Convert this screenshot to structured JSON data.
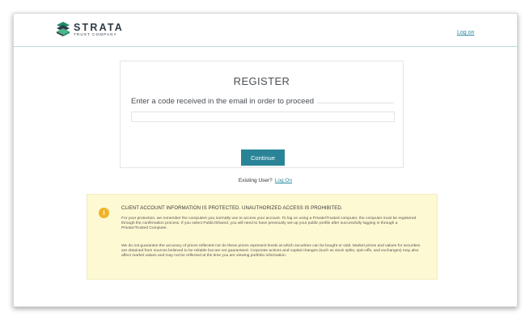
{
  "header": {
    "logo_word": "STRATA",
    "logo_sub": "TRUST COMPANY",
    "login_link": "Log on"
  },
  "register": {
    "title": "REGISTER",
    "prompt": "Enter a code received in the email in order to proceed",
    "code_value": "",
    "continue_label": "Continue"
  },
  "existing": {
    "text": "Existing User?",
    "link": "Log On"
  },
  "notice": {
    "icon": "i",
    "heading": "CLIENT ACCOUNT INFORMATION IS PROTECTED. UNAUTHORIZED ACCESS IS PROHIBITED.",
    "paragraph1": "For your protection, we remember the computers you normally use to access your account. To log on using a Private/Trusted computer, the computer must be registered through the confirmation process. If you select Public/Shared, you will need to have previously set-up your public profile after successfully logging in through a Private/Trusted Computer.",
    "paragraph2": "We do not guarantee the accuracy of prices reflected nor do these prices represent levels at which securities can be bought or sold. Market prices and values for securities are obtained from sources believed to be reliable but are not guaranteed. Corporate actions and capital changes (such as stock splits, spin-offs, and exchanges) may also affect market values and may not be reflected at the time you are viewing portfolio information."
  },
  "colors": {
    "accent": "#2a8497",
    "link": "#2a8aa0",
    "notice_bg": "#fdf9d3",
    "info_icon": "#f0b32a",
    "logo_dark": "#2e3b46",
    "logo_green": "#1f8a6a"
  }
}
